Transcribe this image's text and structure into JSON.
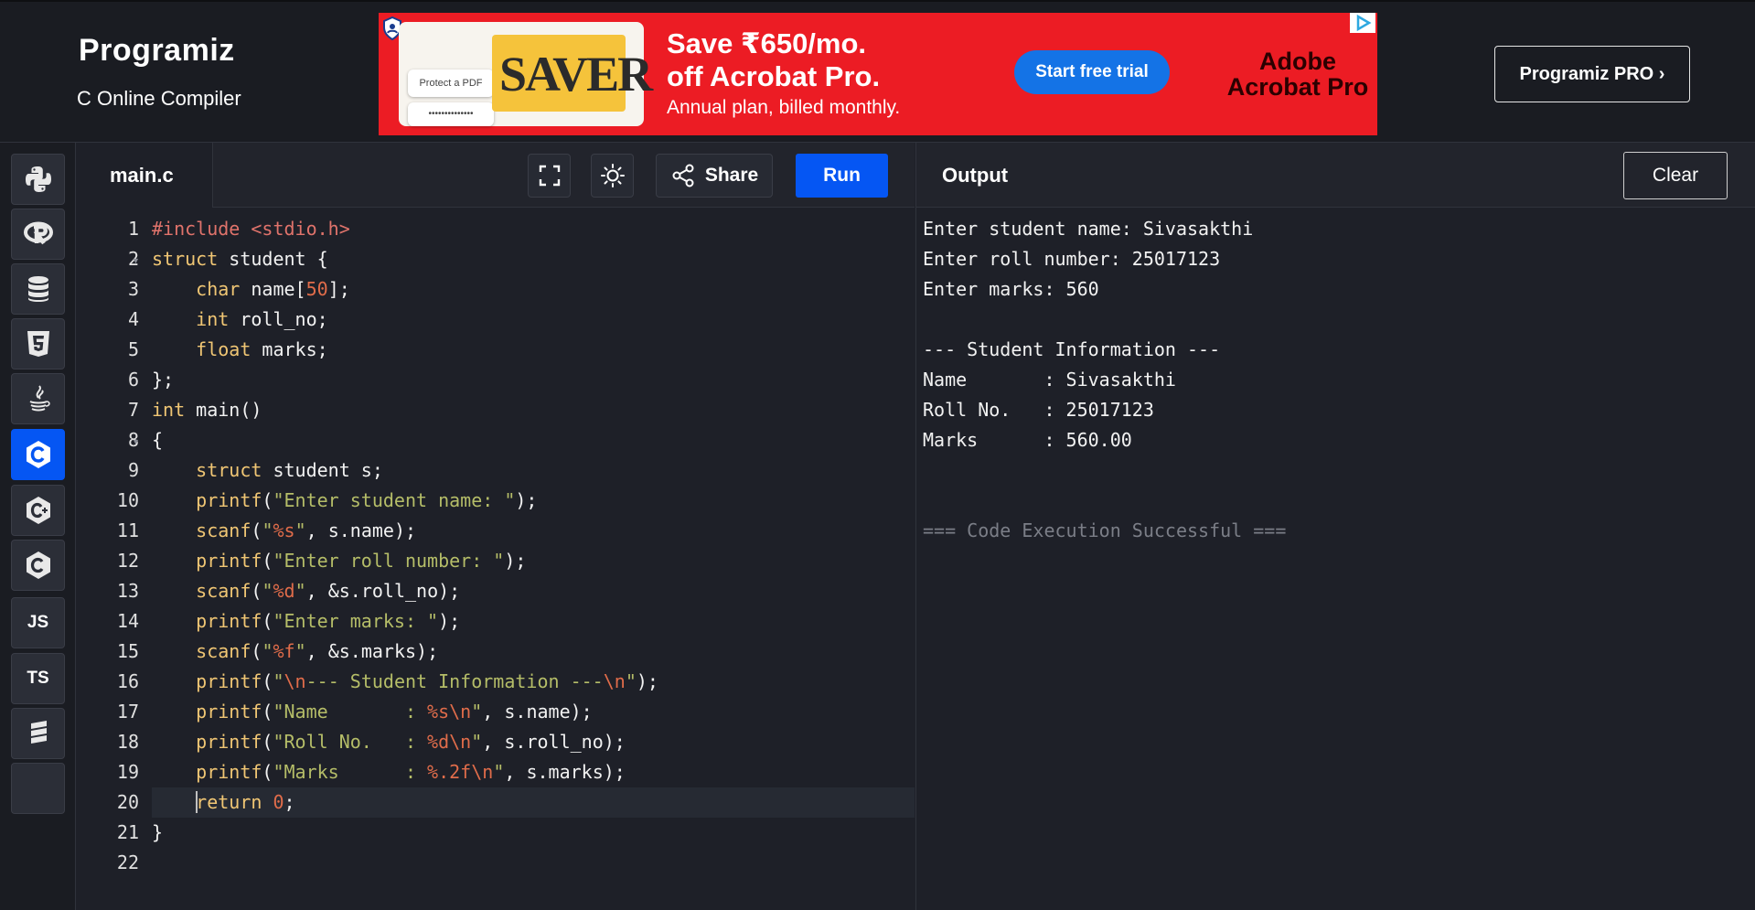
{
  "header": {
    "logo": "Programiz",
    "subtitle": "C Online Compiler",
    "pro_button": "Programiz PRO ›"
  },
  "ad": {
    "card_pill1": "Protect a PDF",
    "card_pill2": "••••••••••••••",
    "card_title": "SAVER",
    "line1": "Save ₹650/mo.",
    "line2": "off Acrobat Pro.",
    "line3": "Annual plan, billed monthly.",
    "cta": "Start free trial",
    "brand_line1": "Adobe",
    "brand_line2": "Acrobat Pro",
    "bg_color": "#ec1c24"
  },
  "sidebar": {
    "items": [
      {
        "name": "python",
        "icon": "python-icon",
        "label": ""
      },
      {
        "name": "r",
        "icon": "r-icon",
        "label": ""
      },
      {
        "name": "sql",
        "icon": "database-icon",
        "label": ""
      },
      {
        "name": "html",
        "icon": "html5-icon",
        "label": ""
      },
      {
        "name": "java",
        "icon": "java-icon",
        "label": ""
      },
      {
        "name": "c",
        "icon": "c-icon",
        "label": "",
        "active": true
      },
      {
        "name": "cpp",
        "icon": "cpp-icon",
        "label": ""
      },
      {
        "name": "csharp",
        "icon": "csharp-icon",
        "label": ""
      },
      {
        "name": "javascript",
        "icon": "js-icon",
        "label": "JS"
      },
      {
        "name": "typescript",
        "icon": "ts-icon",
        "label": "TS"
      },
      {
        "name": "swift",
        "icon": "swift-icon",
        "label": ""
      }
    ],
    "accent_color": "#0556f3"
  },
  "editor": {
    "file_name": "main.c",
    "share_label": "Share",
    "run_label": "Run",
    "line_numbers": [
      "1",
      "2",
      "3",
      "4",
      "5",
      "6",
      "7",
      "8",
      "9",
      "10",
      "11",
      "12",
      "13",
      "14",
      "15",
      "16",
      "17",
      "18",
      "19",
      "20",
      "21",
      "22"
    ],
    "lines": [
      "#include <stdio.h>",
      "struct student {",
      "    char name[50];",
      "    int roll_no;",
      "    float marks;",
      "};",
      "int main()",
      "{",
      "    struct student s;",
      "    printf(\"Enter student name: \");",
      "    scanf(\"%s\", s.name);",
      "    printf(\"Enter roll number: \");",
      "    scanf(\"%d\", &s.roll_no);",
      "    printf(\"Enter marks: \");",
      "    scanf(\"%f\", &s.marks);",
      "    printf(\"\\n--- Student Information ---\\n\");",
      "    printf(\"Name       : %s\\n\", s.name);",
      "    printf(\"Roll No.   : %d\\n\", s.roll_no);",
      "    printf(\"Marks      : %.2f\\n\", s.marks);",
      "    return 0;",
      "}",
      ""
    ],
    "active_line": 20
  },
  "output": {
    "title": "Output",
    "clear_label": "Clear",
    "lines": [
      "Enter student name: Sivasakthi",
      "Enter roll number: 25017123",
      "Enter marks: 560",
      "",
      "--- Student Information ---",
      "Name       : Sivasakthi",
      "Roll No.   : 25017123",
      "Marks      : 560.00",
      "",
      "",
      "=== Code Execution Successful ==="
    ]
  }
}
